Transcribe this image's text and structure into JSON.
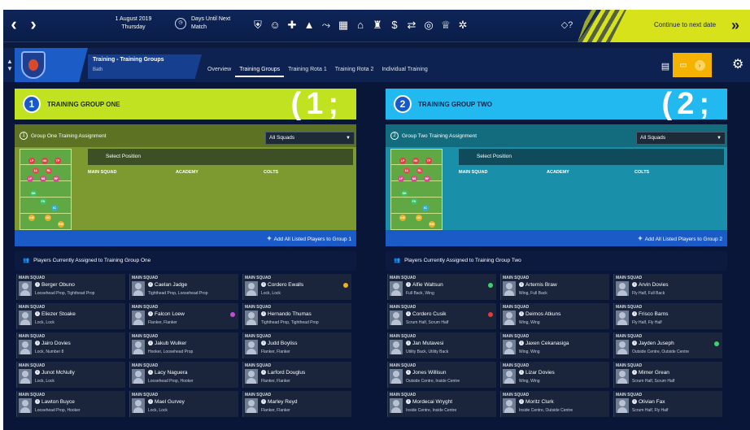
{
  "topbar": {
    "date_line1": "1 August 2019",
    "date_line2": "Thursday",
    "days_line1": "Days Until Next",
    "days_line2": "Match",
    "continue_label": "Continue to next date",
    "icons": [
      "shield-icon",
      "person-icon",
      "medical-icon",
      "cone-icon",
      "tactics-icon",
      "calendar-icon",
      "home-icon",
      "club-icon",
      "finance-icon",
      "transfer-icon",
      "target-icon",
      "trophy-icon",
      "staff-icon"
    ]
  },
  "subbar": {
    "title": "Training - Training Groups",
    "subtitle": "Bath",
    "tabs": [
      "Overview",
      "Training Groups",
      "Training Rota 1",
      "Training Rota 2",
      "Individual Training"
    ],
    "active_tab": "Training Groups"
  },
  "groups": [
    {
      "number": "1",
      "title": "TRAINING GROUP ONE",
      "assignment_label": "Group One Training Assignment",
      "select_value": "All Squads",
      "select_position": "Select Position",
      "columns": [
        "MAIN SQUAD",
        "ACADEMY",
        "COLTS"
      ],
      "add_all_label": "Add All Listed Players to Group 1",
      "players_head": "Players Currently Assigned to Training Group One",
      "players": [
        {
          "squad": "MAIN SQUAD",
          "name": "Berger Obuno",
          "position": "Loosehead Prop, Tighthead Prop",
          "dot": ""
        },
        {
          "squad": "MAIN SQUAD",
          "name": "Caelan Jadge",
          "position": "Tighthead Prop, Loosehead Prop",
          "dot": ""
        },
        {
          "squad": "MAIN SQUAD",
          "name": "Cordero Ewalls",
          "position": "Lock, Lock",
          "dot": "#f2b21c"
        },
        {
          "squad": "MAIN SQUAD",
          "name": "Eliezer Stoake",
          "position": "Lock, Lock",
          "dot": ""
        },
        {
          "squad": "MAIN SQUAD",
          "name": "Falcon Loew",
          "position": "Flanker, Flanker",
          "dot": "#c64bd8"
        },
        {
          "squad": "MAIN SQUAD",
          "name": "Hernando Thumas",
          "position": "Tighthead Prop, Tighthead Prop",
          "dot": ""
        },
        {
          "squad": "MAIN SQUAD",
          "name": "Jairo Dovies",
          "position": "Lock, Number 8",
          "dot": ""
        },
        {
          "squad": "MAIN SQUAD",
          "name": "Jakub Wulker",
          "position": "Hooker, Loosehead Prop",
          "dot": ""
        },
        {
          "squad": "MAIN SQUAD",
          "name": "Judd Boyliss",
          "position": "Flanker, Flanker",
          "dot": ""
        },
        {
          "squad": "MAIN SQUAD",
          "name": "Junot McNully",
          "position": "Lock, Lock",
          "dot": ""
        },
        {
          "squad": "MAIN SQUAD",
          "name": "Lacy Naguera",
          "position": "Loosehead Prop, Hooker",
          "dot": ""
        },
        {
          "squad": "MAIN SQUAD",
          "name": "Larford Douglus",
          "position": "Flanker, Flanker",
          "dot": ""
        },
        {
          "squad": "MAIN SQUAD",
          "name": "Lawton Buyce",
          "position": "Loosehead Prop, Hooker",
          "dot": ""
        },
        {
          "squad": "MAIN SQUAD",
          "name": "Mael Gurvey",
          "position": "Lock, Lock",
          "dot": ""
        },
        {
          "squad": "MAIN SQUAD",
          "name": "Marley Reyd",
          "position": "Flanker, Flanker",
          "dot": ""
        }
      ]
    },
    {
      "number": "2",
      "title": "TRAINING GROUP TWO",
      "assignment_label": "Group Two Training Assignment",
      "select_value": "All Squads",
      "select_position": "Select Position",
      "columns": [
        "MAIN SQUAD",
        "ACADEMY",
        "COLTS"
      ],
      "add_all_label": "Add All Listed Players to Group 2",
      "players_head": "Players Currently Assigned to Training Group Two",
      "players": [
        {
          "squad": "MAIN SQUAD",
          "name": "Alfie Waltsun",
          "position": "Full Back, Wing",
          "dot": "#3cd46a"
        },
        {
          "squad": "MAIN SQUAD",
          "name": "Artemis Braw",
          "position": "Wing, Full Back",
          "dot": ""
        },
        {
          "squad": "MAIN SQUAD",
          "name": "Arvin Dovies",
          "position": "Fly Half, Full Back",
          "dot": ""
        },
        {
          "squad": "MAIN SQUAD",
          "name": "Cordero Cusik",
          "position": "Scrum Half, Scrum Half",
          "dot": "#e23b3b"
        },
        {
          "squad": "MAIN SQUAD",
          "name": "Deimos Atkuns",
          "position": "Wing, Wing",
          "dot": ""
        },
        {
          "squad": "MAIN SQUAD",
          "name": "Frisco Barns",
          "position": "Fly Half, Fly Half",
          "dot": ""
        },
        {
          "squad": "MAIN SQUAD",
          "name": "Jan Mutavesi",
          "position": "Utility Back, Utility Back",
          "dot": ""
        },
        {
          "squad": "MAIN SQUAD",
          "name": "Jaxen Cekanasiga",
          "position": "Wing, Wing",
          "dot": ""
        },
        {
          "squad": "MAIN SQUAD",
          "name": "Jayden Juseph",
          "position": "Outside Centre, Outside Centre",
          "dot": "#3cd46a"
        },
        {
          "squad": "MAIN SQUAD",
          "name": "Jones Willisun",
          "position": "Outside Centre, Inside Centre",
          "dot": ""
        },
        {
          "squad": "MAIN SQUAD",
          "name": "Lizar Dovies",
          "position": "Wing, Wing",
          "dot": ""
        },
        {
          "squad": "MAIN SQUAD",
          "name": "Mimer Grean",
          "position": "Scrum Half, Scrum Half",
          "dot": ""
        },
        {
          "squad": "MAIN SQUAD",
          "name": "Mordecai Wryght",
          "position": "Inside Centre, Inside Centre",
          "dot": ""
        },
        {
          "squad": "MAIN SQUAD",
          "name": "Moritz Clurk",
          "position": "Inside Centre, Outside Centre",
          "dot": ""
        },
        {
          "squad": "MAIN SQUAD",
          "name": "Olivian Fax",
          "position": "Scrum Half, Fly Half",
          "dot": ""
        }
      ]
    }
  ],
  "pitch_positions": [
    "LP",
    "HK",
    "TP",
    "LL",
    "RL",
    "LF",
    "N8",
    "RF",
    "SH",
    "FH",
    "IC",
    "LW",
    "OC",
    "RW",
    "FB"
  ]
}
